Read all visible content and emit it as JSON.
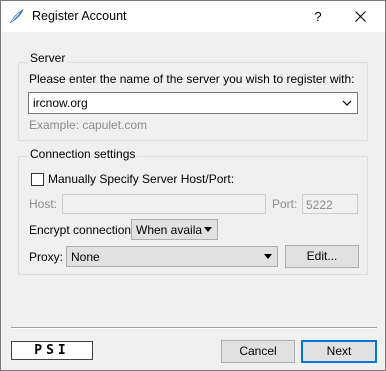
{
  "window": {
    "title": "Register Account",
    "help_label": "?",
    "icons": {
      "app": "psi-feather-icon",
      "close": "close-icon"
    }
  },
  "server": {
    "group_title": "Server",
    "prompt": "Please enter the name of the server you wish to register with:",
    "value": "ircnow.org",
    "example": "Example: capulet.com"
  },
  "connection": {
    "group_title": "Connection settings",
    "manual_label": "Manually Specify Server Host/Port:",
    "manual_checked": false,
    "host_label": "Host:",
    "host_value": "",
    "port_label": "Port:",
    "port_value": "5222",
    "encrypt_label": "Encrypt connection:",
    "encrypt_value": "When availab",
    "proxy_label": "Proxy:",
    "proxy_value": "None",
    "edit_label": "Edit..."
  },
  "footer": {
    "logo_text": "PSI",
    "cancel_label": "Cancel",
    "next_label": "Next"
  }
}
